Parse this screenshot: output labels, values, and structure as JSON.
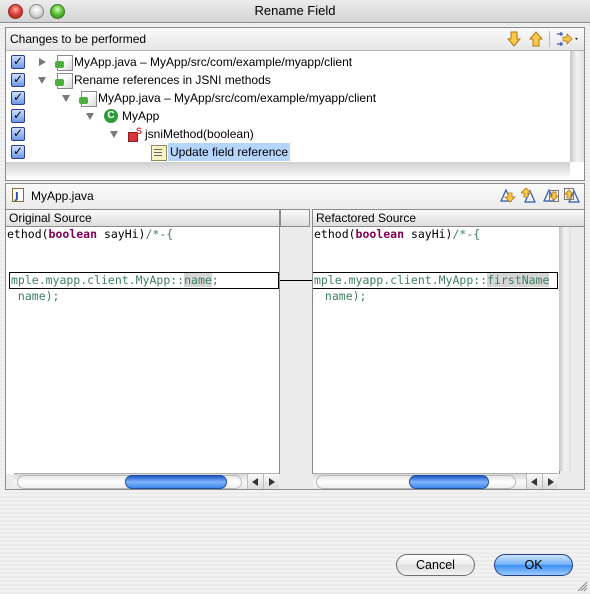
{
  "window": {
    "title": "Rename Field"
  },
  "changes_panel": {
    "header": "Changes to be performed",
    "toolbar": {
      "next_change": "down-arrow-icon",
      "previous_change": "up-arrow-icon",
      "filter": "filter-changes-icon"
    },
    "tree": [
      {
        "label": "MyApp.java – MyApp/src/com/example/myapp/client",
        "checked": true,
        "expanded": false,
        "icon": "compilation-unit-icon",
        "level": 0
      },
      {
        "label": "Rename references in JSNI methods",
        "checked": true,
        "expanded": true,
        "icon": "change-group-icon",
        "level": 0
      },
      {
        "label": "MyApp.java – MyApp/src/com/example/myapp/client",
        "checked": true,
        "expanded": true,
        "icon": "compilation-unit-icon",
        "level": 1
      },
      {
        "label": "MyApp",
        "checked": true,
        "expanded": true,
        "icon": "class-icon",
        "level": 2
      },
      {
        "label": "jsniMethod(boolean)",
        "checked": true,
        "expanded": true,
        "icon": "static-method-icon",
        "level": 3
      },
      {
        "label": "Update field reference",
        "checked": true,
        "selected": true,
        "icon": "text-edit-icon",
        "level": 4
      }
    ]
  },
  "compare_panel": {
    "file_label": "MyApp.java",
    "toolbar": [
      "next-difference-icon",
      "previous-difference-icon",
      "next-change-icon",
      "previous-change-icon"
    ],
    "original": {
      "header": "Original Source",
      "lines": [
        {
          "pre": "ethod(",
          "kw": "boolean",
          "mid": " sayHi)",
          "cm": "/*-{"
        },
        {
          "text": ""
        },
        {
          "text": ""
        },
        {
          "cm_pre": "mple.myapp.client.MyApp::",
          "hl": "name",
          "cm_post": ";"
        },
        {
          "cm_pre": " name);"
        }
      ]
    },
    "refactored": {
      "header": "Refactored Source",
      "lines": [
        {
          "pre": "ethod(",
          "kw": "boolean",
          "mid": " sayHi)",
          "cm": "/*-{"
        },
        {
          "text": ""
        },
        {
          "text": ""
        },
        {
          "cm_pre": "mple.myapp.client.MyApp::",
          "hl": "firstName",
          "cm_post": ""
        },
        {
          "cm_pre": " name);"
        }
      ]
    }
  },
  "buttons": {
    "cancel": "Cancel",
    "ok": "OK"
  },
  "colors": {
    "keyword": "#7f0055",
    "comment": "#3f7f5f",
    "selection": "#b6d5fc",
    "ok_button": "#3a8ef0"
  }
}
